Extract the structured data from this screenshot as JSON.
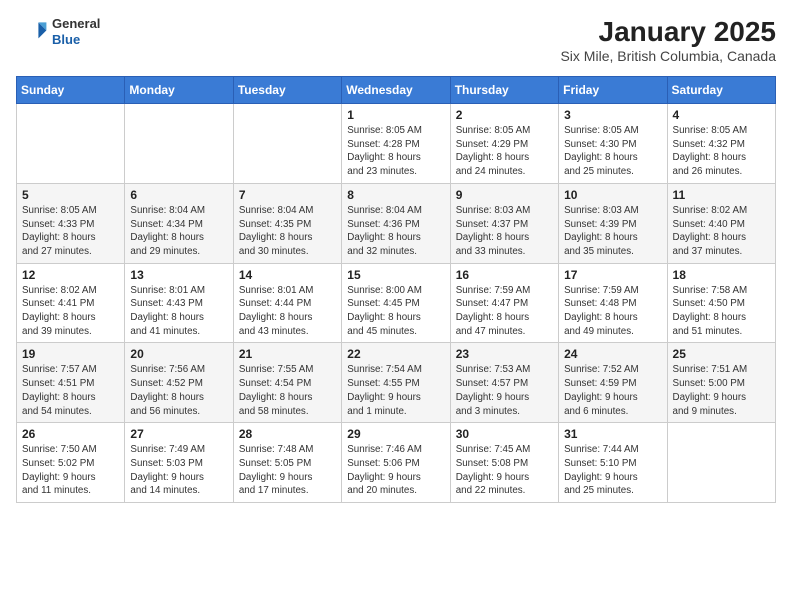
{
  "header": {
    "logo_line1": "General",
    "logo_line2": "Blue",
    "title": "January 2025",
    "subtitle": "Six Mile, British Columbia, Canada"
  },
  "weekdays": [
    "Sunday",
    "Monday",
    "Tuesday",
    "Wednesday",
    "Thursday",
    "Friday",
    "Saturday"
  ],
  "weeks": [
    [
      {
        "day": "",
        "detail": ""
      },
      {
        "day": "",
        "detail": ""
      },
      {
        "day": "",
        "detail": ""
      },
      {
        "day": "1",
        "detail": "Sunrise: 8:05 AM\nSunset: 4:28 PM\nDaylight: 8 hours\nand 23 minutes."
      },
      {
        "day": "2",
        "detail": "Sunrise: 8:05 AM\nSunset: 4:29 PM\nDaylight: 8 hours\nand 24 minutes."
      },
      {
        "day": "3",
        "detail": "Sunrise: 8:05 AM\nSunset: 4:30 PM\nDaylight: 8 hours\nand 25 minutes."
      },
      {
        "day": "4",
        "detail": "Sunrise: 8:05 AM\nSunset: 4:32 PM\nDaylight: 8 hours\nand 26 minutes."
      }
    ],
    [
      {
        "day": "5",
        "detail": "Sunrise: 8:05 AM\nSunset: 4:33 PM\nDaylight: 8 hours\nand 27 minutes."
      },
      {
        "day": "6",
        "detail": "Sunrise: 8:04 AM\nSunset: 4:34 PM\nDaylight: 8 hours\nand 29 minutes."
      },
      {
        "day": "7",
        "detail": "Sunrise: 8:04 AM\nSunset: 4:35 PM\nDaylight: 8 hours\nand 30 minutes."
      },
      {
        "day": "8",
        "detail": "Sunrise: 8:04 AM\nSunset: 4:36 PM\nDaylight: 8 hours\nand 32 minutes."
      },
      {
        "day": "9",
        "detail": "Sunrise: 8:03 AM\nSunset: 4:37 PM\nDaylight: 8 hours\nand 33 minutes."
      },
      {
        "day": "10",
        "detail": "Sunrise: 8:03 AM\nSunset: 4:39 PM\nDaylight: 8 hours\nand 35 minutes."
      },
      {
        "day": "11",
        "detail": "Sunrise: 8:02 AM\nSunset: 4:40 PM\nDaylight: 8 hours\nand 37 minutes."
      }
    ],
    [
      {
        "day": "12",
        "detail": "Sunrise: 8:02 AM\nSunset: 4:41 PM\nDaylight: 8 hours\nand 39 minutes."
      },
      {
        "day": "13",
        "detail": "Sunrise: 8:01 AM\nSunset: 4:43 PM\nDaylight: 8 hours\nand 41 minutes."
      },
      {
        "day": "14",
        "detail": "Sunrise: 8:01 AM\nSunset: 4:44 PM\nDaylight: 8 hours\nand 43 minutes."
      },
      {
        "day": "15",
        "detail": "Sunrise: 8:00 AM\nSunset: 4:45 PM\nDaylight: 8 hours\nand 45 minutes."
      },
      {
        "day": "16",
        "detail": "Sunrise: 7:59 AM\nSunset: 4:47 PM\nDaylight: 8 hours\nand 47 minutes."
      },
      {
        "day": "17",
        "detail": "Sunrise: 7:59 AM\nSunset: 4:48 PM\nDaylight: 8 hours\nand 49 minutes."
      },
      {
        "day": "18",
        "detail": "Sunrise: 7:58 AM\nSunset: 4:50 PM\nDaylight: 8 hours\nand 51 minutes."
      }
    ],
    [
      {
        "day": "19",
        "detail": "Sunrise: 7:57 AM\nSunset: 4:51 PM\nDaylight: 8 hours\nand 54 minutes."
      },
      {
        "day": "20",
        "detail": "Sunrise: 7:56 AM\nSunset: 4:52 PM\nDaylight: 8 hours\nand 56 minutes."
      },
      {
        "day": "21",
        "detail": "Sunrise: 7:55 AM\nSunset: 4:54 PM\nDaylight: 8 hours\nand 58 minutes."
      },
      {
        "day": "22",
        "detail": "Sunrise: 7:54 AM\nSunset: 4:55 PM\nDaylight: 9 hours\nand 1 minute."
      },
      {
        "day": "23",
        "detail": "Sunrise: 7:53 AM\nSunset: 4:57 PM\nDaylight: 9 hours\nand 3 minutes."
      },
      {
        "day": "24",
        "detail": "Sunrise: 7:52 AM\nSunset: 4:59 PM\nDaylight: 9 hours\nand 6 minutes."
      },
      {
        "day": "25",
        "detail": "Sunrise: 7:51 AM\nSunset: 5:00 PM\nDaylight: 9 hours\nand 9 minutes."
      }
    ],
    [
      {
        "day": "26",
        "detail": "Sunrise: 7:50 AM\nSunset: 5:02 PM\nDaylight: 9 hours\nand 11 minutes."
      },
      {
        "day": "27",
        "detail": "Sunrise: 7:49 AM\nSunset: 5:03 PM\nDaylight: 9 hours\nand 14 minutes."
      },
      {
        "day": "28",
        "detail": "Sunrise: 7:48 AM\nSunset: 5:05 PM\nDaylight: 9 hours\nand 17 minutes."
      },
      {
        "day": "29",
        "detail": "Sunrise: 7:46 AM\nSunset: 5:06 PM\nDaylight: 9 hours\nand 20 minutes."
      },
      {
        "day": "30",
        "detail": "Sunrise: 7:45 AM\nSunset: 5:08 PM\nDaylight: 9 hours\nand 22 minutes."
      },
      {
        "day": "31",
        "detail": "Sunrise: 7:44 AM\nSunset: 5:10 PM\nDaylight: 9 hours\nand 25 minutes."
      },
      {
        "day": "",
        "detail": ""
      }
    ]
  ]
}
